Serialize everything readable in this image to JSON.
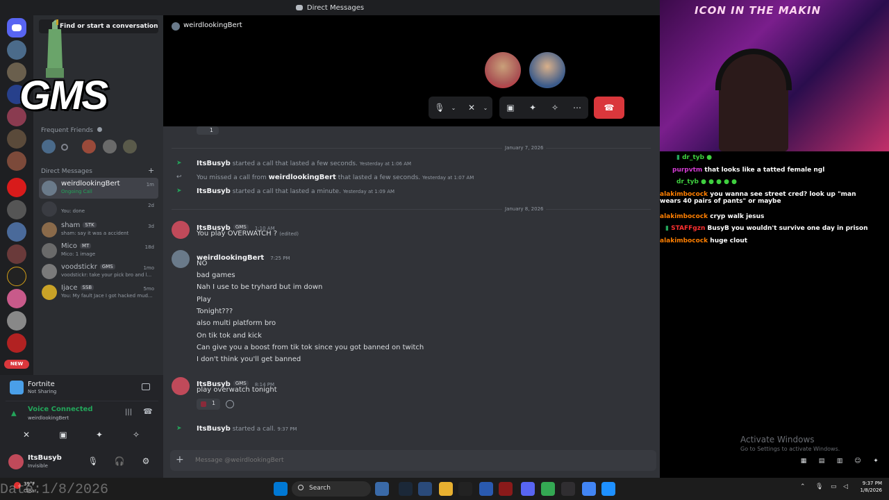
{
  "titlebar": {
    "title": "Direct Messages"
  },
  "sidebar": {
    "search_label": "Find or start a conversation",
    "overlay_logo": "GMS",
    "frequent_friends_label": "Frequent Friends",
    "dm_header": "Direct Messages",
    "add_dm": "+",
    "dms": [
      {
        "name": "weirdlookingBert",
        "sub": "Ongoing Call",
        "time": "1m"
      },
      {
        "name": "",
        "sub": "You: done",
        "time": "2d"
      },
      {
        "name": "sham",
        "tag": "STK",
        "sub": "sham: say it was a accident",
        "time": "3d"
      },
      {
        "name": "Mico",
        "tag": "MT",
        "sub": "Mico: 1 image",
        "time": "18d"
      },
      {
        "name": "voodstickr",
        "tag": "GMS",
        "sub": "voodstickr: take your pick bro and l...",
        "time": "1mo"
      },
      {
        "name": "Ijace",
        "tag": "SSB",
        "sub": "You: My fault Jace I got hacked mud...",
        "time": "5mo"
      }
    ]
  },
  "panel": {
    "game_name": "Fortnite",
    "game_status": "Not Sharing",
    "voice_status": "Voice Connected",
    "voice_channel": "weirdlookingBert",
    "user_name": "ItsBusyb",
    "user_status": "Invisible",
    "new_badge": "NEW"
  },
  "call": {
    "header_name": "weirdlookingBert"
  },
  "chat": {
    "date1": "January 7, 2026",
    "sys1": {
      "name": "ItsBusyb",
      "text": "started a call that lasted a few seconds.",
      "ts": "Yesterday at 1:06 AM"
    },
    "sys2": {
      "prefix": "You missed a call from",
      "name": "weirdlookingBert",
      "text": "that lasted a few seconds.",
      "ts": "Yesterday at 1:07 AM"
    },
    "sys3": {
      "name": "ItsBusyb",
      "text": "started a call that lasted a minute.",
      "ts": "Yesterday at 1:09 AM"
    },
    "date2": "January 8, 2026",
    "msg1": {
      "name": "ItsBusyb",
      "tag": "GMS",
      "ts": "1:10 AM",
      "body": "You play OVERWATCH ?",
      "edited": "(edited)"
    },
    "msg2": {
      "name": "weirdlookingBert",
      "ts": "7:25 PM",
      "lines": [
        "NO",
        "bad games",
        "Nah I use to be tryhard but im down",
        "Play",
        "Tonight???",
        "also multi platform bro",
        "On tik tok and kick",
        "Can give you a boost from tik tok since you got banned on twitch",
        "I don't think you'll get banned"
      ]
    },
    "msg3": {
      "name": "ItsBusyb",
      "tag": "GMS",
      "ts": "8:14 PM",
      "body": "play overwatch tonight",
      "reaction_count": "1"
    },
    "sys4": {
      "name": "ItsBusyb",
      "text": "started a call.",
      "ts": "9:37 PM"
    },
    "top_reaction_count": "1",
    "input_placeholder": "Message @weirdlookingBert"
  },
  "webcam": {
    "banner": "ICON IN THE MAKIN"
  },
  "twitch_chat": [
    {
      "user": "dr_tyb",
      "text": "",
      "color": "#3fcf3f"
    },
    {
      "user": "purpvtm",
      "text": "that looks like a tatted female ngl",
      "color": "#d43cd4"
    },
    {
      "user": "dr_tyb",
      "text": "",
      "color": "#3fcf3f"
    },
    {
      "user": "alakimbocock",
      "text": "you wanna see street cred? look up \"man wears 40 pairs of pants\" or maybe",
      "color": "#ff7f00"
    },
    {
      "user": "alakimbocock",
      "text": "cryp walk jesus",
      "color": "#ff7f00"
    },
    {
      "user": "STAFFgzn",
      "text": "BusyB you wouldn't survive one day in prison",
      "color": "#ff3030"
    },
    {
      "user": "alakimbocock",
      "text": "huge clout",
      "color": "#ff7f00"
    }
  ],
  "activate": {
    "title": "Activate Windows",
    "sub": "Go to Settings to activate Windows."
  },
  "taskbar": {
    "search": "Search",
    "time": "9:37 PM",
    "date": "1/8/2026",
    "weather": "39°F",
    "weather_sub": "Clear",
    "watermark": "Date:1/8/2026"
  },
  "colors": {
    "accent": "#5865f2",
    "green": "#23a55a",
    "red": "#da373c"
  }
}
